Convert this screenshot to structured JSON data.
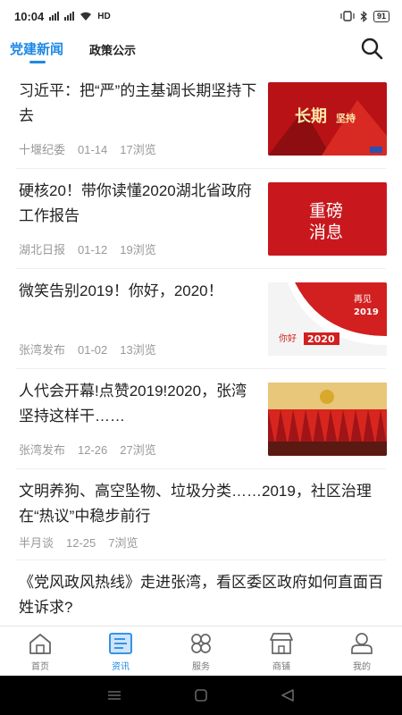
{
  "status_bar": {
    "time": "10:04",
    "network": "HD",
    "battery": "91"
  },
  "tabs": [
    {
      "label": "党建新闻",
      "active": true
    },
    {
      "label": "政策公示",
      "active": false
    }
  ],
  "news": [
    {
      "title": "习近平：把“严”的主基调长期坚持下去",
      "source": "十堰纪委",
      "date": "01-14",
      "views": "17浏览",
      "thumb_text": [
        "长期",
        "坚持"
      ]
    },
    {
      "title": "硬核20！带你读懂2020湖北省政府工作报告",
      "source": "湖北日报",
      "date": "01-12",
      "views": "19浏览",
      "thumb_text": [
        "重磅",
        "消息"
      ]
    },
    {
      "title": "微笑告别2019！你好，2020！",
      "source": "张湾发布",
      "date": "01-02",
      "views": "13浏览",
      "thumb_text": [
        "再见",
        "2019",
        "你好",
        "2020"
      ]
    },
    {
      "title": "人代会开幕!点赞2019!2020，张湾坚持这样干……",
      "source": "张湾发布",
      "date": "12-26",
      "views": "27浏览"
    },
    {
      "title": "文明养狗、高空坠物、垃圾分类……2019，社区治理在“热议”中稳步前行",
      "source": "半月谈",
      "date": "12-25",
      "views": "7浏览"
    },
    {
      "title": "《党风政风热线》走进张湾，看区委区政府如何直面百姓诉求?"
    }
  ],
  "bottom_nav": [
    {
      "label": "首页",
      "active": false
    },
    {
      "label": "资讯",
      "active": true
    },
    {
      "label": "服务",
      "active": false
    },
    {
      "label": "商铺",
      "active": false
    },
    {
      "label": "我的",
      "active": false
    }
  ],
  "colors": {
    "accent": "#1e88e5",
    "thumb_red": "#c8181e"
  }
}
